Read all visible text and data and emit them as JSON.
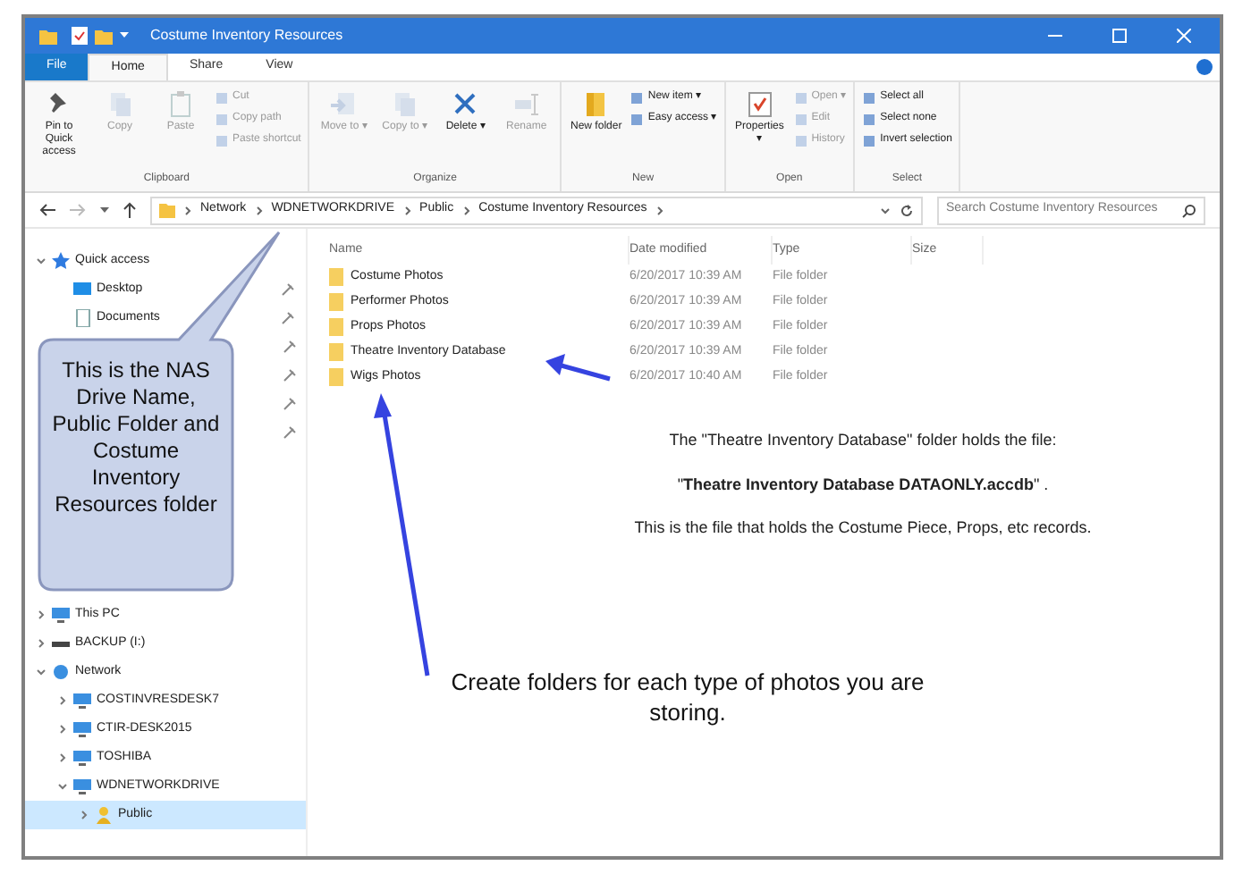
{
  "window": {
    "title": "Costume Inventory Resources"
  },
  "ribbon_tabs": [
    {
      "label": "File",
      "kind": "file"
    },
    {
      "label": "Home",
      "kind": "tab",
      "selected": true
    },
    {
      "label": "Share",
      "kind": "tab",
      "selected": false
    },
    {
      "label": "View",
      "kind": "tab",
      "selected": false
    }
  ],
  "ribbon_groups": [
    {
      "label": "Clipboard",
      "items": [
        {
          "label": "Pin to Quick access",
          "kind": "large",
          "disabled": false
        },
        {
          "label": "Copy",
          "kind": "large",
          "disabled": true
        },
        {
          "label": "Paste",
          "kind": "large",
          "disabled": true
        },
        {
          "kind": "stack",
          "entries": [
            {
              "label": "Cut",
              "disabled": true
            },
            {
              "label": "Copy path",
              "disabled": true
            },
            {
              "label": "Paste shortcut",
              "disabled": true
            }
          ]
        }
      ]
    },
    {
      "label": "Organize",
      "items": [
        {
          "label": "Move to ▾",
          "kind": "large",
          "disabled": true
        },
        {
          "label": "Copy to ▾",
          "kind": "large",
          "disabled": true
        },
        {
          "label": "Delete ▾",
          "kind": "large",
          "disabled": false
        },
        {
          "label": "Rename",
          "kind": "large",
          "disabled": true
        }
      ]
    },
    {
      "label": "New",
      "items": [
        {
          "label": "New folder",
          "kind": "large",
          "disabled": false
        },
        {
          "kind": "stack",
          "entries": [
            {
              "label": "New item ▾",
              "disabled": false
            },
            {
              "label": "Easy access ▾",
              "disabled": false
            }
          ]
        }
      ]
    },
    {
      "label": "Open",
      "items": [
        {
          "label": "Properties ▾",
          "kind": "large",
          "disabled": false
        },
        {
          "kind": "stack",
          "entries": [
            {
              "label": "Open ▾",
              "disabled": true
            },
            {
              "label": "Edit",
              "disabled": true
            },
            {
              "label": "History",
              "disabled": true
            }
          ]
        }
      ]
    },
    {
      "label": "Select",
      "items": [
        {
          "kind": "stack",
          "entries": [
            {
              "label": "Select all",
              "disabled": false
            },
            {
              "label": "Select none",
              "disabled": false
            },
            {
              "label": "Invert selection",
              "disabled": false
            }
          ]
        }
      ]
    }
  ],
  "address_bar": {
    "path": [
      "Network",
      "WDNETWORKDRIVE",
      "Public",
      "Costume Inventory Resources"
    ],
    "search_placeholder": "Search Costume Inventory Resources"
  },
  "navigation": [
    {
      "label": "Quick access",
      "kind": "star",
      "expanded": true,
      "children": [
        {
          "label": "Desktop",
          "kind": "desktop",
          "pinned": true
        },
        {
          "label": "Documents",
          "kind": "documents",
          "pinned": true
        }
      ]
    },
    {
      "label": "This PC",
      "kind": "computer",
      "expanded": false
    },
    {
      "label": "BACKUP (I:)",
      "kind": "drive",
      "expanded": false
    },
    {
      "label": "Network",
      "kind": "network",
      "expanded": true,
      "children": [
        {
          "label": "COSTINVRESDESK7",
          "kind": "computer",
          "expanded": false
        },
        {
          "label": "CTIR-DESK2015",
          "kind": "computer",
          "expanded": false
        },
        {
          "label": "TOSHIBA",
          "kind": "computer",
          "expanded": false
        },
        {
          "label": "WDNETWORKDRIVE",
          "kind": "computer",
          "expanded": true,
          "children": [
            {
              "label": "Public",
              "kind": "share",
              "expanded": false,
              "selected": true
            }
          ]
        }
      ]
    }
  ],
  "table": {
    "columns": [
      "Name",
      "Date modified",
      "Type",
      "Size"
    ],
    "rows": [
      {
        "name": "Costume Photos",
        "date": "6/20/2017 10:39 AM",
        "type": "File folder"
      },
      {
        "name": "Performer Photos",
        "date": "6/20/2017 10:39 AM",
        "type": "File folder"
      },
      {
        "name": "Props Photos",
        "date": "6/20/2017 10:39 AM",
        "type": "File folder"
      },
      {
        "name": "Theatre Inventory Database",
        "date": "6/20/2017 10:39 AM",
        "type": "File folder"
      },
      {
        "name": "Wigs Photos",
        "date": "6/20/2017 10:40 AM",
        "type": "File folder"
      }
    ]
  },
  "annotations": {
    "callout": "This is the NAS Drive Name, Public Folder and Costume Inventory Resources folder",
    "note_lines": [
      "The \"Theatre Inventory Database\" folder holds the file:",
      "\"**Theatre Inventory Database DATAONLY.accdb**\" .",
      "This is the file that holds the Costume Piece, Props, etc records."
    ],
    "folders_note": "Create folders for each type of photos you are storing."
  }
}
